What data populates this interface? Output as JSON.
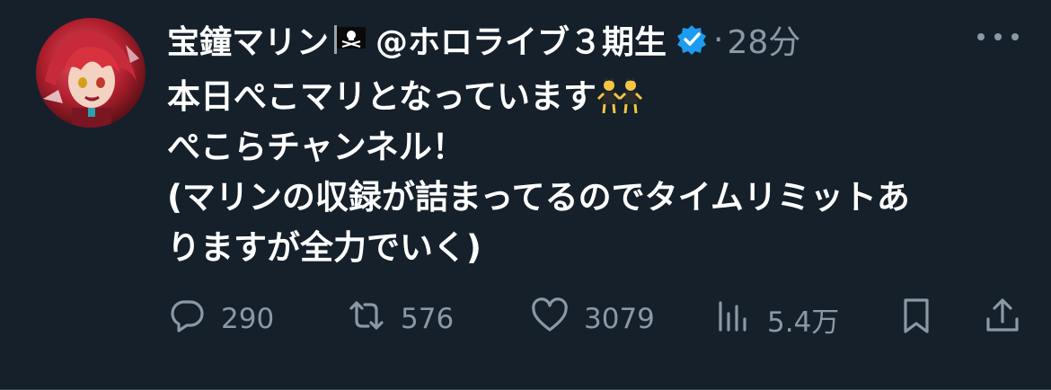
{
  "user": {
    "display_name": "宝鐘マリン",
    "handle": "@ホロライブ３期生",
    "time": "28分",
    "dot": "·"
  },
  "tweet": {
    "line1": "本日ぺこマリとなっています",
    "line2": "ぺこらチャンネル！",
    "line3": "(マリンの収録が詰まってるのでタイムリミットあ",
    "line4": "りますが全力でいく)"
  },
  "actions": {
    "replies": "290",
    "retweets": "576",
    "likes": "3079",
    "views": "5.4万"
  },
  "colors": {
    "background": "#15202b",
    "text": "#ffffff",
    "muted": "#8b98a5",
    "verified": "#1d9bf0"
  },
  "icons": [
    "pirate-flag-icon",
    "verified-badge-icon",
    "more-icon",
    "dancers-emoji-icon",
    "reply-icon",
    "retweet-icon",
    "like-icon",
    "views-icon",
    "bookmark-icon",
    "share-icon"
  ]
}
